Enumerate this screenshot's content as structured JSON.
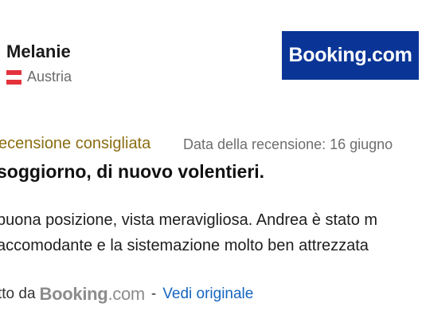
{
  "reviewer": {
    "name": "Melanie",
    "country": "Austria",
    "flag_colors": [
      "#e4323c",
      "#ffffff",
      "#e4323c"
    ]
  },
  "provider_logo": {
    "text": "Booking.com",
    "background": "#0a3596"
  },
  "review": {
    "badge": "ecensione consigliata",
    "date": "Data della recensione: 16 giugno",
    "title": "soggiorno, di nuovo volentieri.",
    "body_lines": [
      "buona posizione, vista meravigliosa. Andrea è stato m",
      "accomodante e la sistemazione molto ben attrezzata"
    ]
  },
  "source": {
    "prefix": "tto da",
    "brand_main": "Booking",
    "brand_suffix": ".com",
    "separator": "-",
    "link_label": "Vedi originale",
    "link_color": "#1565c0"
  }
}
